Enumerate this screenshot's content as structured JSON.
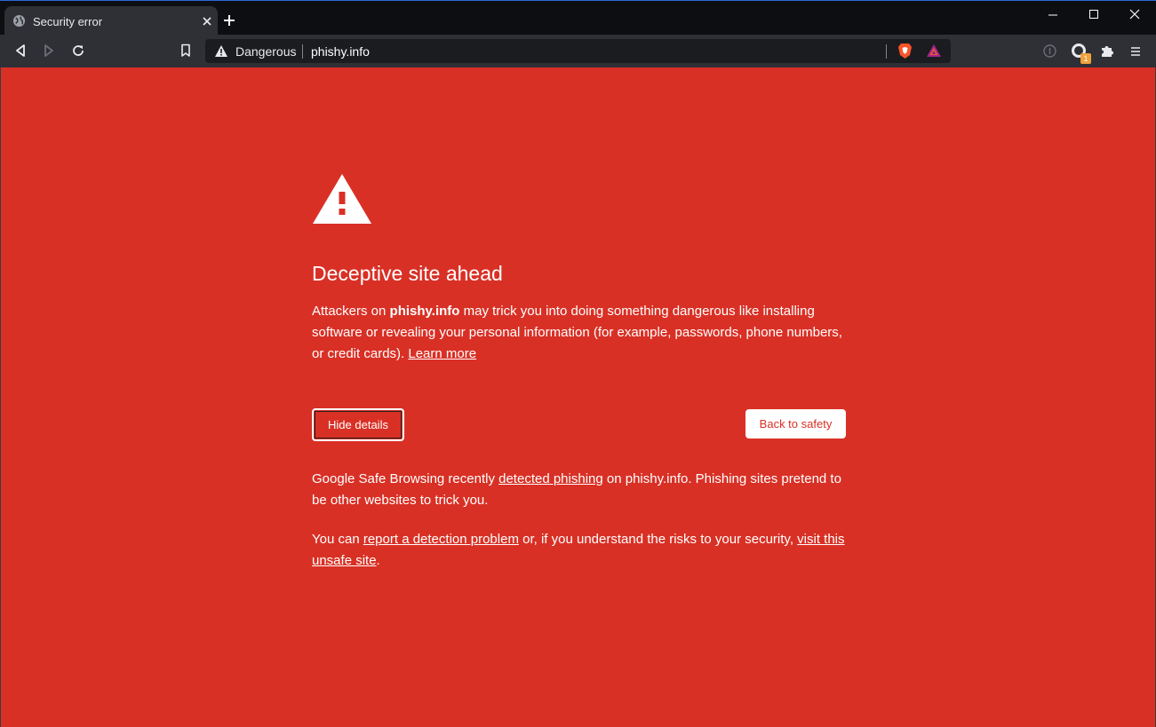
{
  "browser": {
    "tab_title": "Security error",
    "security_label": "Dangerous",
    "url": "phishy.info",
    "rewards_badge": "1",
    "icons": {
      "tab": "globe-icon",
      "back": "back-arrow-icon",
      "forward": "forward-arrow-icon",
      "reload": "reload-icon",
      "bookmark": "bookmark-icon",
      "shields": "brave-shields-icon",
      "rewards": "brave-rewards-icon",
      "wallet": "wallet-icon",
      "extension": "brave-extension-icon",
      "extensions": "puzzle-icon",
      "menu": "hamburger-menu-icon"
    }
  },
  "page": {
    "heading": "Deceptive site ahead",
    "para1": {
      "prefix": "Attackers on ",
      "site": "phishy.info",
      "middle": " may trick you into doing something dangerous like installing software or revealing your personal information (for example, passwords, phone numbers, or credit cards). ",
      "link": "Learn more"
    },
    "buttons": {
      "hide_details": "Hide details",
      "back_to_safety": "Back to safety"
    },
    "details1": {
      "prefix": "Google Safe Browsing recently ",
      "link": "detected phishing",
      "suffix": " on phishy.info. Phishing sites pretend to be other websites to trick you."
    },
    "details2": {
      "prefix": "You can ",
      "link1": "report a detection problem",
      "middle": " or, if you understand the risks to your security, ",
      "link2": "visit this unsafe site",
      "suffix": "."
    }
  },
  "colors": {
    "danger_background": "#d93025",
    "titlebar": "#0d0e12",
    "toolbar": "#2e3036",
    "omnibox": "#1b1c20",
    "brave_orange": "#fb542b"
  }
}
